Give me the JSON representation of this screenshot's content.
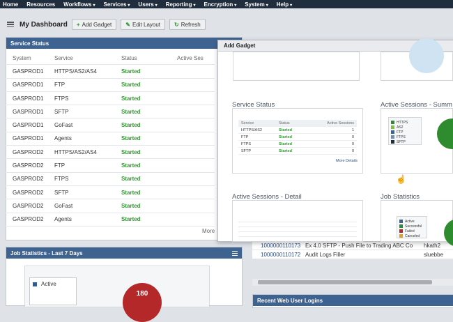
{
  "nav": {
    "items": [
      {
        "label": "Home",
        "caret": ""
      },
      {
        "label": "Resources",
        "caret": ""
      },
      {
        "label": "Workflows",
        "caret": "▾"
      },
      {
        "label": "Services",
        "caret": "▾"
      },
      {
        "label": "Users",
        "caret": "▾"
      },
      {
        "label": "Reporting",
        "caret": "▾"
      },
      {
        "label": "Encryption",
        "caret": "▾"
      },
      {
        "label": "System",
        "caret": "▾"
      },
      {
        "label": "Help",
        "caret": "▾"
      }
    ]
  },
  "toolbar": {
    "title": "My Dashboard",
    "add_gadget": "Add Gadget",
    "edit_layout": "Edit Layout",
    "refresh": "Refresh"
  },
  "service_status": {
    "title": "Service Status",
    "headers": [
      "System",
      "Service",
      "Status",
      "Active Ses"
    ],
    "rows": [
      {
        "system": "GASPROD1",
        "service": "HTTPS/AS2/AS4",
        "status": "Started"
      },
      {
        "system": "GASPROD1",
        "service": "FTP",
        "status": "Started"
      },
      {
        "system": "GASPROD1",
        "service": "FTPS",
        "status": "Started"
      },
      {
        "system": "GASPROD1",
        "service": "SFTP",
        "status": "Started"
      },
      {
        "system": "GASPROD1",
        "service": "GoFast",
        "status": "Started"
      },
      {
        "system": "GASPROD1",
        "service": "Agents",
        "status": "Started"
      },
      {
        "system": "GASPROD2",
        "service": "HTTPS/AS2/AS4",
        "status": "Started"
      },
      {
        "system": "GASPROD2",
        "service": "FTP",
        "status": "Started"
      },
      {
        "system": "GASPROD2",
        "service": "FTPS",
        "status": "Started"
      },
      {
        "system": "GASPROD2",
        "service": "SFTP",
        "status": "Started"
      },
      {
        "system": "GASPROD2",
        "service": "GoFast",
        "status": "Started"
      },
      {
        "system": "GASPROD2",
        "service": "Agents",
        "status": "Started"
      }
    ],
    "more": "More"
  },
  "job_statistics": {
    "title": "Job Statistics - Last 7 Days",
    "legend_active": "Active",
    "pie_value": "180"
  },
  "jobs": [
    {
      "id": "1000000110173",
      "name": "Ex 4.0 SFTP - Push File to Trading ABC Co",
      "user": "hkath2"
    },
    {
      "id": "1000000110172",
      "name": "Audit Logs Filler",
      "user": "sluebbe"
    }
  ],
  "web_logins": {
    "title": "Recent Web User Logins"
  },
  "add_gadget_modal": {
    "title": "Add Gadget",
    "cards": {
      "service_status": "Service Status",
      "active_sessions_summary": "Active Sessions - Summ",
      "active_sessions_detail": "Active Sessions - Detail",
      "job_statistics": "Job Statistics"
    },
    "preview_service": {
      "headers": [
        "Service",
        "Status",
        "Active Sessions"
      ],
      "rows": [
        {
          "service": "HTTPS/AS2",
          "status": "Started",
          "sessions": "1"
        },
        {
          "service": "FTP",
          "status": "Started",
          "sessions": "0"
        },
        {
          "service": "FTPS",
          "status": "Started",
          "sessions": "0"
        },
        {
          "service": "SFTP",
          "status": "Started",
          "sessions": "0"
        }
      ],
      "more": "More Details"
    },
    "preview_sessions_legend": [
      "HTTPS",
      "AS2",
      "FTP",
      "FTPS",
      "SFTP"
    ],
    "preview_job_legend": [
      "Active",
      "Successful",
      "Failed",
      "Canceled"
    ]
  },
  "colors": {
    "nav_bg": "#1f2d3d",
    "panel_header": "#3f6391",
    "started_green": "#2f9a2f",
    "pie_red": "#b5282a"
  }
}
